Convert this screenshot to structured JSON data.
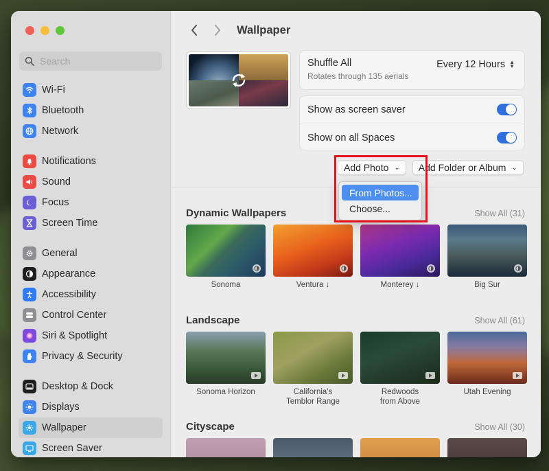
{
  "window": {
    "title": "Wallpaper"
  },
  "sidebar": {
    "search_placeholder": "Search",
    "groups": [
      [
        {
          "label": "Wi-Fi",
          "icon": "wifi-icon",
          "color": "#3d84f0"
        },
        {
          "label": "Bluetooth",
          "icon": "bluetooth-icon",
          "color": "#3d84f0"
        },
        {
          "label": "Network",
          "icon": "globe-icon",
          "color": "#3d84f0"
        }
      ],
      [
        {
          "label": "Notifications",
          "icon": "bell-icon",
          "color": "#ec4b44"
        },
        {
          "label": "Sound",
          "icon": "speaker-icon",
          "color": "#ec4b44"
        },
        {
          "label": "Focus",
          "icon": "moon-icon",
          "color": "#6a5fd6"
        },
        {
          "label": "Screen Time",
          "icon": "hourglass-icon",
          "color": "#6a5fd6"
        }
      ],
      [
        {
          "label": "General",
          "icon": "gear-icon",
          "color": "#8e8e93"
        },
        {
          "label": "Appearance",
          "icon": "appearance-icon",
          "color": "#1f1f1f"
        },
        {
          "label": "Accessibility",
          "icon": "accessibility-icon",
          "color": "#2e7cf6"
        },
        {
          "label": "Control Center",
          "icon": "control-center-icon",
          "color": "#8e8e93"
        },
        {
          "label": "Siri & Spotlight",
          "icon": "siri-icon",
          "color": "#7b4ae0"
        },
        {
          "label": "Privacy & Security",
          "icon": "hand-icon",
          "color": "#3d84f0"
        }
      ],
      [
        {
          "label": "Desktop & Dock",
          "icon": "dock-icon",
          "color": "#1f1f1f"
        },
        {
          "label": "Displays",
          "icon": "sun-icon",
          "color": "#3d84f0"
        },
        {
          "label": "Wallpaper",
          "icon": "wallpaper-icon",
          "color": "#3aa8e8",
          "selected": true
        },
        {
          "label": "Screen Saver",
          "icon": "screen-saver-icon",
          "color": "#3aa8e8"
        }
      ]
    ]
  },
  "toolbar": {
    "back": "‹",
    "forward": "›",
    "title": "Wallpaper"
  },
  "shuffle": {
    "title": "Shuffle All",
    "subtitle": "Rotates through 135 aerials",
    "frequency": "Every 12 Hours"
  },
  "toggles": [
    {
      "label": "Show as screen saver",
      "on": true
    },
    {
      "label": "Show on all Spaces",
      "on": true
    }
  ],
  "buttons": {
    "add_photo": "Add Photo",
    "add_folder": "Add Folder or Album"
  },
  "dropdown": {
    "items": [
      "From Photos...",
      "Choose..."
    ],
    "active_index": 0
  },
  "sections": [
    {
      "title": "Dynamic Wallpapers",
      "show_all": "Show All (31)",
      "items": [
        {
          "label": "Sonoma",
          "kind": "dynamic",
          "bg": "linear-gradient(135deg,#2e7a3e 0%,#62a84a 35%,#3a6a5a 50%,#2c5a6a 70%,#1f3a5a 100%)"
        },
        {
          "label": "Ventura ↓",
          "kind": "dynamic",
          "bg": "linear-gradient(160deg,#f2a030 0%,#e8601c 45%,#c0381a 75%,#7a1a10 100%)"
        },
        {
          "label": "Monterey ↓",
          "kind": "dynamic",
          "bg": "linear-gradient(160deg,#b03a8a 0%,#7a2ab0 40%,#4a2a9a 70%,#2a1a5a 100%)"
        },
        {
          "label": "Big Sur",
          "kind": "dynamic",
          "bg": "linear-gradient(180deg,#3a5a7a 0%,#5a7a8a 30%,#4a5a5a 60%,#1a2a3a 100%)"
        }
      ]
    },
    {
      "title": "Landscape",
      "show_all": "Show All (61)",
      "items": [
        {
          "label": "Sonoma Horizon",
          "kind": "video",
          "bg": "linear-gradient(180deg,#8aa0b0 0%,#5a7a5a 35%,#3a5a3a 70%,#2a3a2a 100%)"
        },
        {
          "label": "California's\nTemblor Range",
          "kind": "video",
          "bg": "linear-gradient(150deg,#8a9a4a 0%,#a0a060 40%,#6a7a3a 70%,#4a5a2a 100%)"
        },
        {
          "label": "Redwoods\nfrom Above",
          "kind": "video",
          "bg": "linear-gradient(160deg,#1a3a2a 0%,#2a4a3a 40%,#1a2a1a 100%)"
        },
        {
          "label": "Utah Evening",
          "kind": "video",
          "bg": "linear-gradient(180deg,#4a6a9a 0%,#8a7aa0 30%,#c06a3a 60%,#6a2a1a 100%)"
        }
      ]
    },
    {
      "title": "Cityscape",
      "show_all": "Show All (30)",
      "items": [
        {
          "label": "",
          "kind": "video",
          "bg": "linear-gradient(180deg,#c0a0b0 0%,#a08090 100%)"
        },
        {
          "label": "",
          "kind": "video",
          "bg": "linear-gradient(180deg,#4a5a6a 0%,#7a8a9a 100%)"
        },
        {
          "label": "",
          "kind": "video",
          "bg": "linear-gradient(180deg,#e0a050 0%,#c07030 100%)"
        },
        {
          "label": "",
          "kind": "video",
          "bg": "linear-gradient(180deg,#5a4a4a 0%,#3a2a2a 100%)"
        }
      ]
    }
  ],
  "accent_color": "#2f6fe0",
  "highlight_color": "#e5121b"
}
